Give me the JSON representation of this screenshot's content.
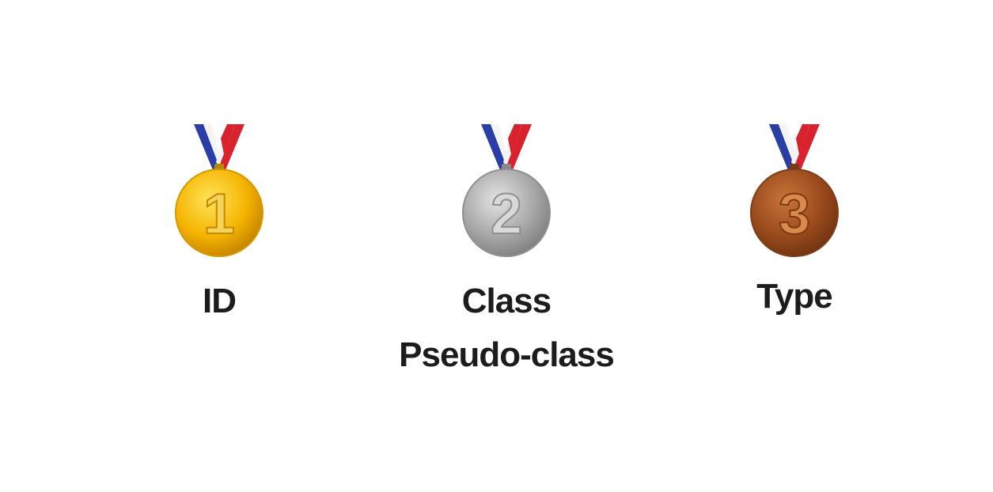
{
  "medals": [
    {
      "rank": "1",
      "icon": "gold-medal-icon",
      "colors": {
        "light": "#ffe45c",
        "mid": "#f5b400",
        "dark": "#c27f00",
        "digit": "#f3d35a"
      },
      "labels": [
        "ID"
      ]
    },
    {
      "rank": "2",
      "icon": "silver-medal-icon",
      "colors": {
        "light": "#e4e4e4",
        "mid": "#a8a8a8",
        "dark": "#7d7d7d",
        "digit": "#d9d9d9"
      },
      "labels": [
        "Class",
        "Pseudo-class"
      ]
    },
    {
      "rank": "3",
      "icon": "bronze-medal-icon",
      "colors": {
        "light": "#c9743a",
        "mid": "#9a4a1c",
        "dark": "#6e3210",
        "digit": "#d98a4a"
      },
      "labels": [
        "Type"
      ]
    }
  ],
  "ribbon_colors": {
    "blue": "#2b3ea8",
    "white": "#f4f4f4",
    "red": "#d8232f"
  }
}
